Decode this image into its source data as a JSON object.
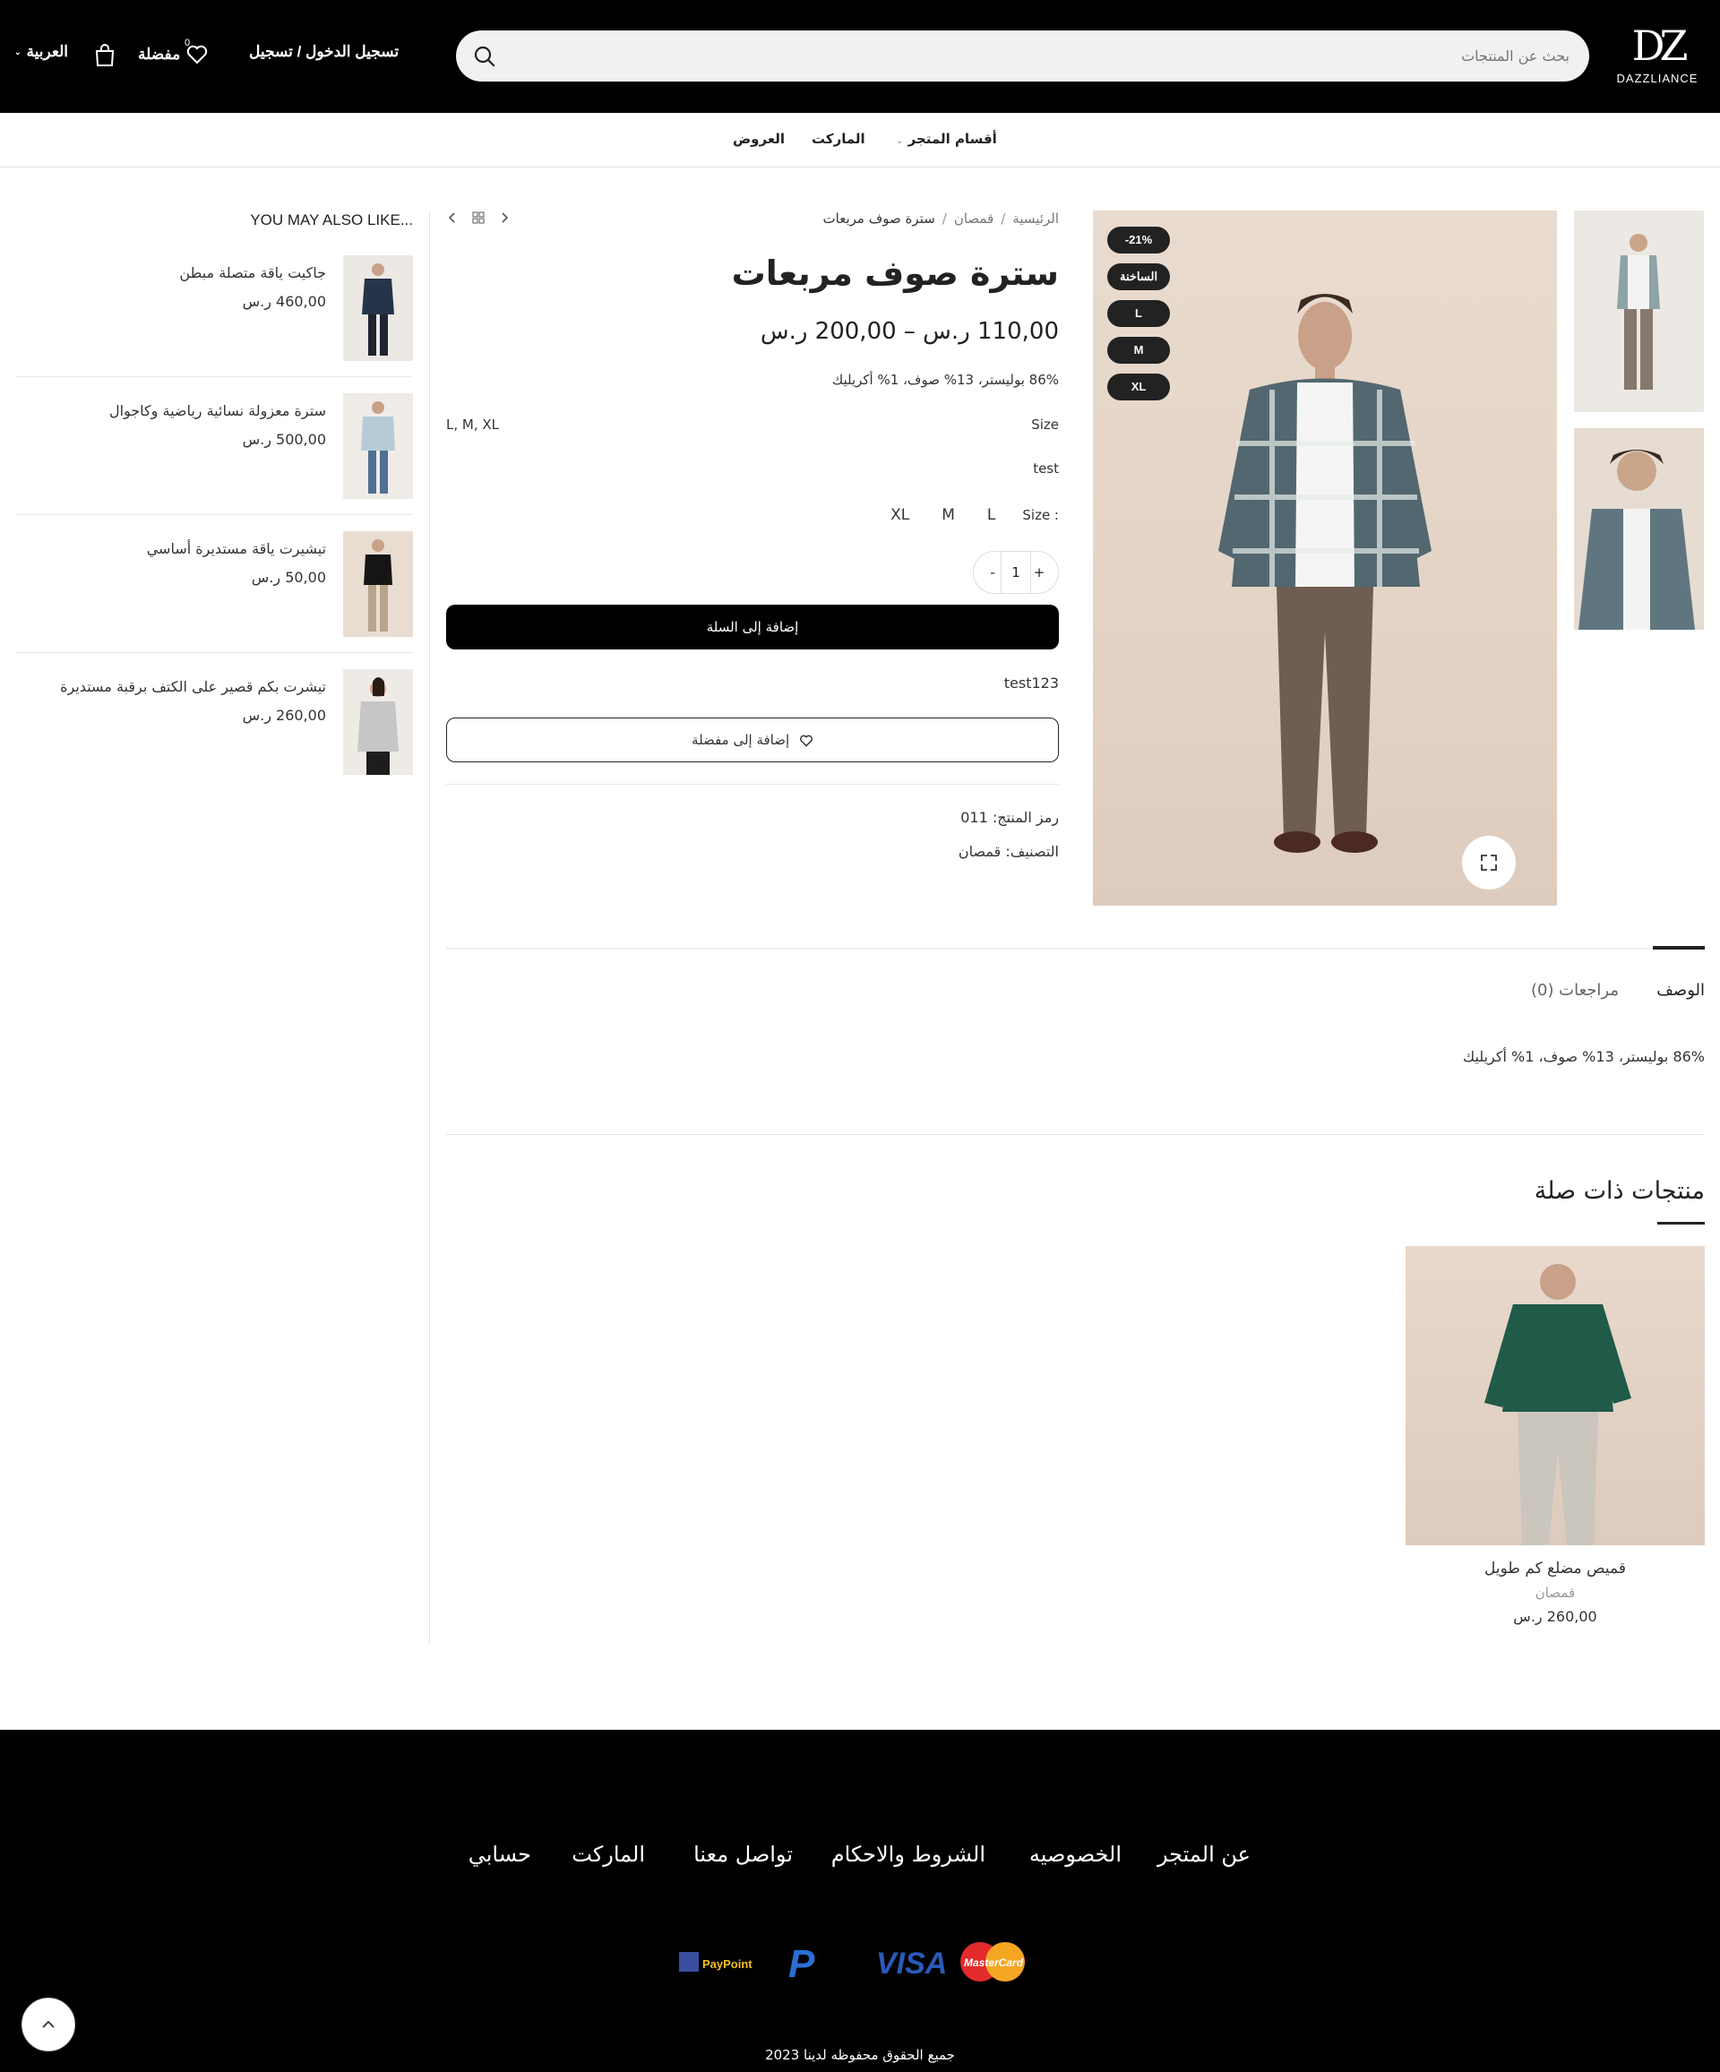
{
  "header": {
    "logo_text": "DAZZLIANCE",
    "logo_mark": "DZ",
    "search_placeholder": "بحث عن المنتجات",
    "login_label": "تسجيل الدخول / تسجيل",
    "wishlist_label": "مفضلة",
    "cart_count": "0",
    "language_label": "العربية"
  },
  "nav": {
    "items": [
      {
        "label": "أقسام المتجر"
      },
      {
        "label": "الماركت"
      },
      {
        "label": "العروض"
      }
    ]
  },
  "product": {
    "breadcrumb": [
      "الرئيسية",
      "قمصان",
      "سترة صوف مربعات"
    ],
    "title": "سترة صوف مربعات",
    "price_range": "110,00 ر.س – 200,00 ر.س",
    "short_description": "86% بوليستر، 13% صوف، 1% أكريليك",
    "attributes": [
      {
        "key": "Size",
        "value": "L, M, XL"
      },
      {
        "key": "test",
        "value": ""
      }
    ],
    "size_label": "Size :",
    "sizes": [
      "L",
      "M",
      "XL"
    ],
    "quantity": "1",
    "add_to_cart": "إضافة إلى السلة",
    "extra_note": "test123",
    "add_to_wishlist": "إضافة إلى مفضلة",
    "sku_line": "رمز المنتج: 011",
    "category_line": "التصنيف: قمصان",
    "badges": [
      "-21%",
      "الساخنة",
      "L",
      "M",
      "XL"
    ]
  },
  "tabs": {
    "description_label": "الوصف",
    "reviews_label": "مراجعات (0)",
    "description_text": "86% بوليستر، 13% صوف، 1% أكريليك"
  },
  "related": {
    "title": "منتجات ذات صلة",
    "items": [
      {
        "name": "قميص مضلع كم طويل",
        "category": "قمصان",
        "price": "260,00 ر.س"
      }
    ]
  },
  "sidebar": {
    "title": "YOU MAY ALSO LIKE...",
    "items": [
      {
        "name": "جاكيت ياقة متصلة مبطن",
        "price": "460,00 ر.س"
      },
      {
        "name": "سترة معزولة نسائية رياضية وكاجوال",
        "price": "500,00 ر.س"
      },
      {
        "name": "تيشيرت ياقة مستديرة أساسي",
        "price": "50,00 ر.س"
      },
      {
        "name": "تيشرت بكم قصير على الكتف برقبة مستديرة",
        "price": "260,00 ر.س"
      }
    ]
  },
  "footer": {
    "links": [
      "عن المتجر",
      "الخصوصيه",
      "الشروط والاحكام",
      "تواصل معنا",
      "الماركت",
      "حسابي"
    ],
    "payment_methods": [
      "mastercard",
      "visa",
      "paypal",
      "paypoint"
    ],
    "payment_labels": {
      "mastercard": "MasterCard",
      "visa": "VISA",
      "paypal": "P",
      "paypoint": "PayPoint"
    },
    "copyright": "جميع الحقوق محفوظه لدينا 2023"
  }
}
